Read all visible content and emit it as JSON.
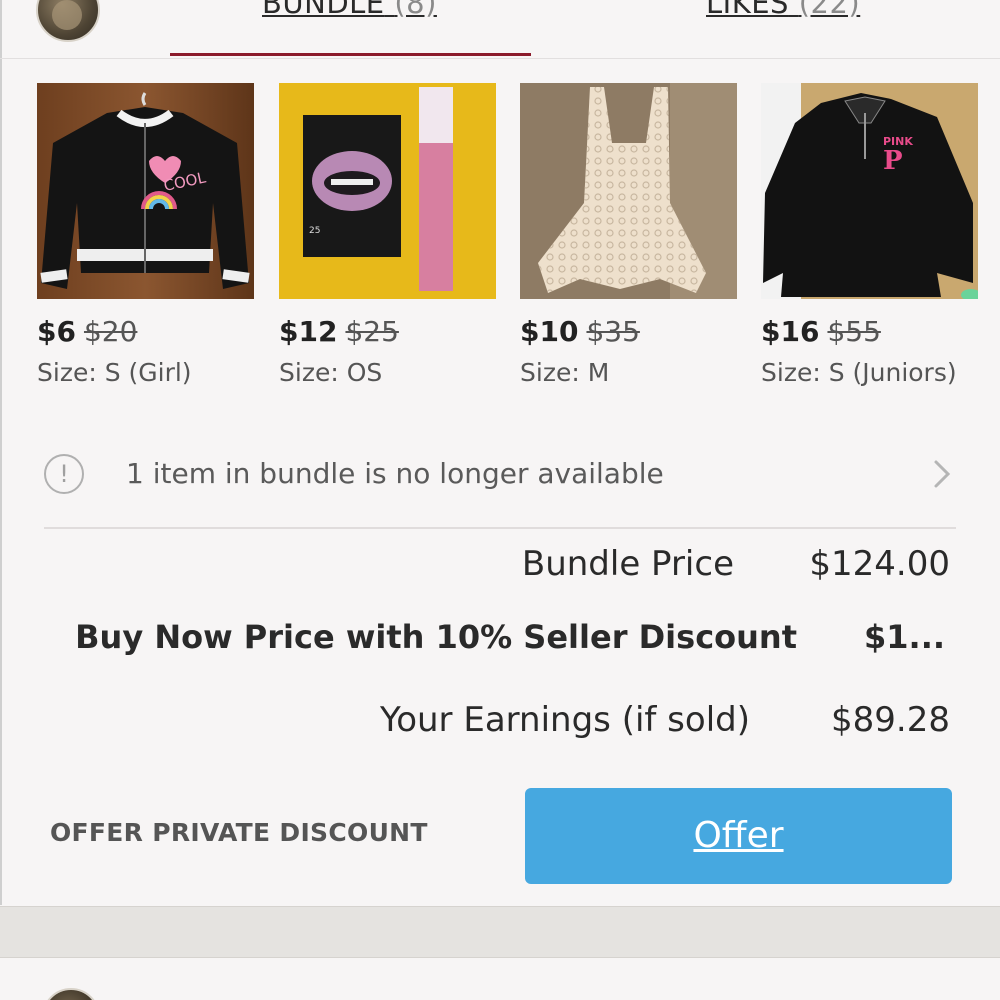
{
  "tabs": [
    {
      "label": "BUNDLE",
      "count": "(8)"
    },
    {
      "label": "LIKES",
      "count": "(22)"
    }
  ],
  "products": [
    {
      "price": "$6",
      "original_price": "$20",
      "size": "Size: S (Girl)"
    },
    {
      "price": "$12",
      "original_price": "$25",
      "size": "Size: OS"
    },
    {
      "price": "$10",
      "original_price": "$35",
      "size": "Size: M"
    },
    {
      "price": "$16",
      "original_price": "$55",
      "size": "Size: S (Juniors)"
    }
  ],
  "notice": {
    "icon": "alert-circle-icon",
    "text": "1 item in bundle is no longer available"
  },
  "summary": {
    "bundle_price_label": "Bundle Price",
    "bundle_price_value": "$124.00",
    "buy_now_label": "Buy Now Price with 10% Seller Discount",
    "buy_now_value": "$1...",
    "earnings_label": "Your Earnings (if sold)",
    "earnings_value": "$89.28"
  },
  "actions": {
    "private_discount_label": "OFFER PRIVATE DISCOUNT",
    "offer_label": "Offer"
  },
  "colors": {
    "offer_button": "#46a8e0",
    "tab_indicator": "#8b1a2b"
  }
}
